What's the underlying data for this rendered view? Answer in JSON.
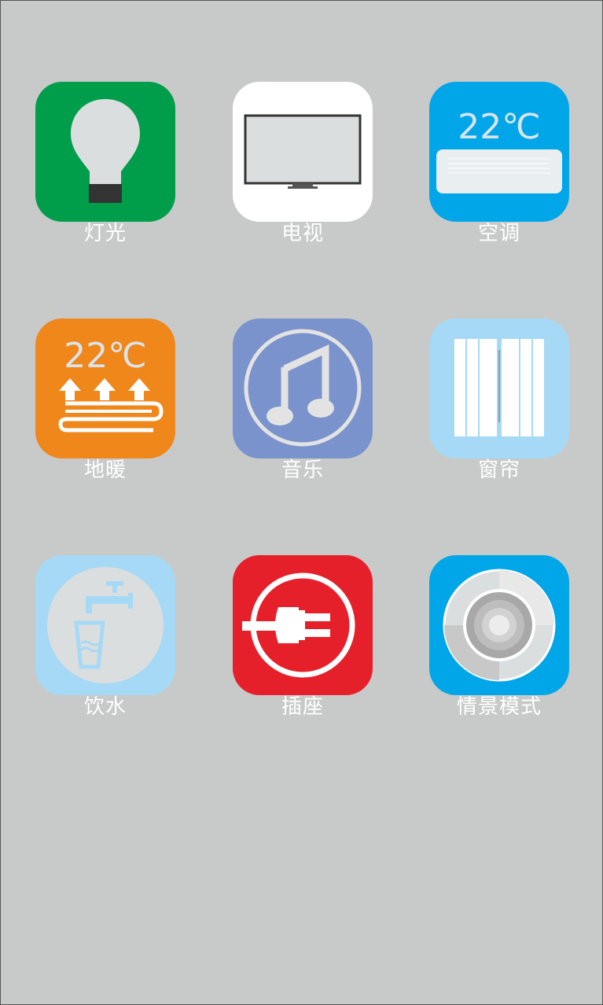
{
  "apps": [
    {
      "label": "灯光",
      "icon": "light-bulb-icon",
      "color": "#009e4b"
    },
    {
      "label": "电视",
      "icon": "tv-icon",
      "color": "#ffffff"
    },
    {
      "label": "空调",
      "icon": "air-conditioner-icon",
      "color": "#00a6e8",
      "temperature": "22℃"
    },
    {
      "label": "地暖",
      "icon": "floor-heating-icon",
      "color": "#ef871b",
      "temperature": "22℃"
    },
    {
      "label": "音乐",
      "icon": "music-note-icon",
      "color": "#7b93cc"
    },
    {
      "label": "窗帘",
      "icon": "curtain-icon",
      "color": "#a6d9f5"
    },
    {
      "label": "饮水",
      "icon": "water-tap-cup-icon",
      "color": "#a6d9f5"
    },
    {
      "label": "插座",
      "icon": "power-plug-icon",
      "color": "#e6202a"
    },
    {
      "label": "情景模式",
      "icon": "scene-mode-icon",
      "color": "#00a6e8"
    }
  ]
}
